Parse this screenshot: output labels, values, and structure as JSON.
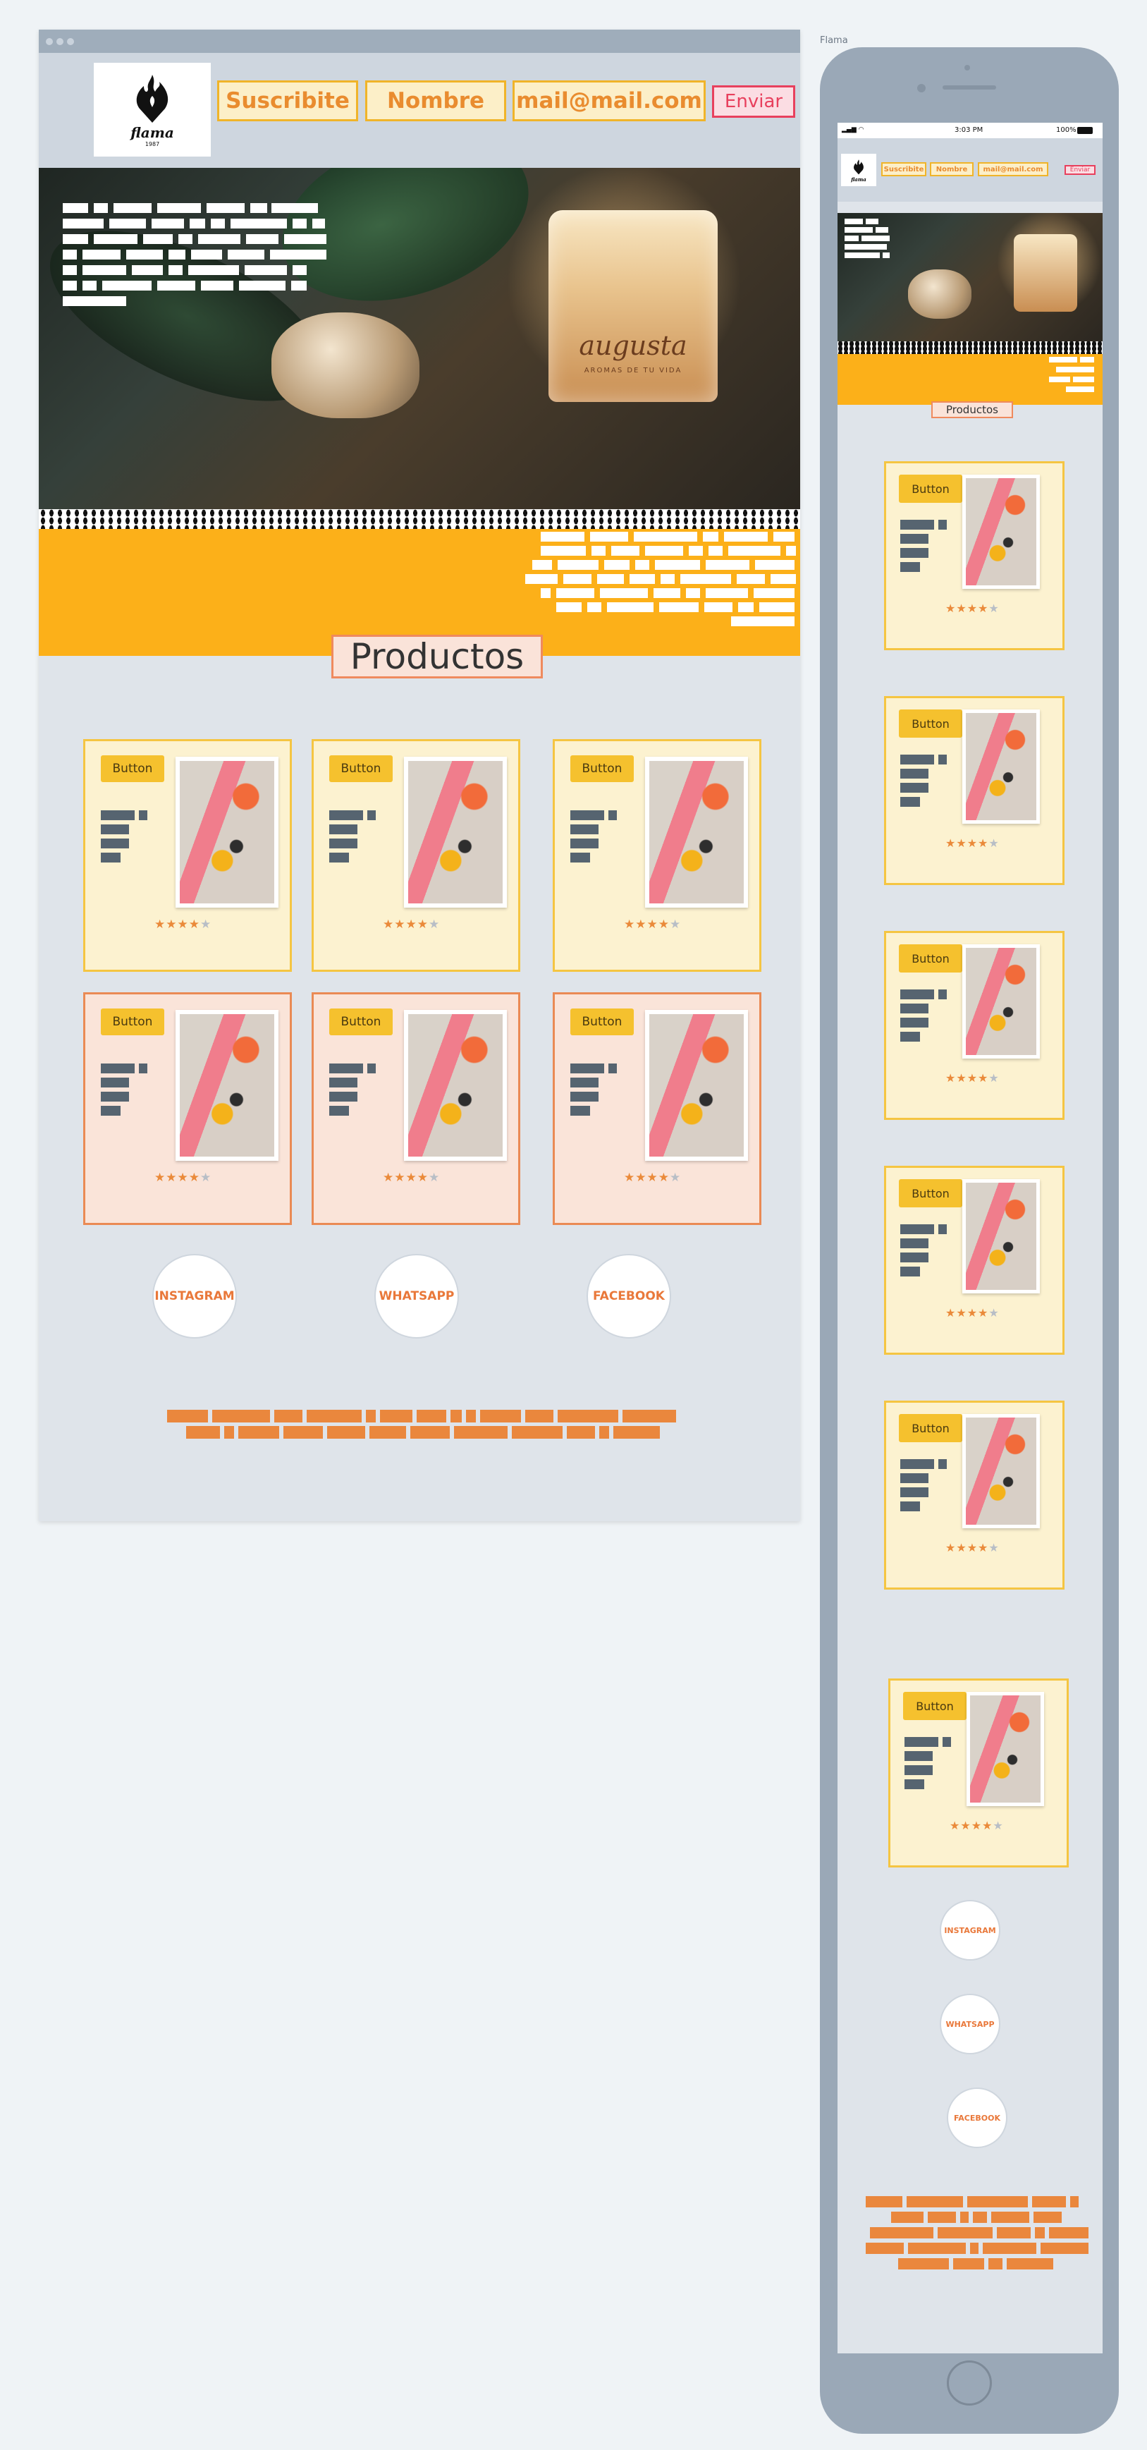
{
  "artboard": {
    "label": "Flama"
  },
  "brand": {
    "logo_text": "flama",
    "logo_sub": "1987"
  },
  "header": {
    "subscribe_label": "Suscribite",
    "name_placeholder": "Nombre",
    "email_placeholder": "mail@mail.com",
    "send_label": "Enviar"
  },
  "hero": {
    "jar_brand": "augusta",
    "jar_tagline": "AROMAS DE TU VIDA"
  },
  "section": {
    "products_title": "Productos"
  },
  "products": [
    {
      "button_label": "Button",
      "rating": 4,
      "max_rating": 5
    },
    {
      "button_label": "Button",
      "rating": 4,
      "max_rating": 5
    },
    {
      "button_label": "Button",
      "rating": 4,
      "max_rating": 5
    },
    {
      "button_label": "Button",
      "rating": 4,
      "max_rating": 5
    },
    {
      "button_label": "Button",
      "rating": 4,
      "max_rating": 5
    },
    {
      "button_label": "Button",
      "rating": 4,
      "max_rating": 5
    }
  ],
  "social": {
    "instagram": "INSTAGRAM",
    "whatsapp": "WHATSAPP",
    "facebook": "FACEBOOK"
  },
  "mobile": {
    "status_time": "3:03 PM",
    "status_battery": "100%",
    "subscribe_label": "Suscribite",
    "name_placeholder": "Nombre",
    "email_placeholder": "mail@mail.com",
    "send_label": "Enviar",
    "products_title": "Productos",
    "card_button_label": "Button",
    "instagram": "INSTAGRAM",
    "whatsapp": "WHATSAPP",
    "facebook": "FACEBOOK"
  },
  "colors": {
    "accent_yellow": "#fcb019",
    "accent_orange": "#ea873d",
    "send_red": "#e8405d",
    "frame_gray": "#9aa8b7"
  }
}
